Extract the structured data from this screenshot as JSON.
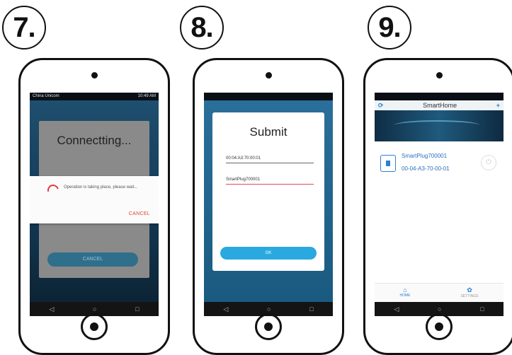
{
  "steps": [
    "7.",
    "8.",
    "9."
  ],
  "phone7": {
    "status_left": "China Unicom",
    "status_right": "10:49 AM",
    "dialog_title": "Connectting...",
    "alert_message": "Operation is taking place, please wait...",
    "alert_cancel": "CANCEL",
    "dialog_cancel": "CANCEL"
  },
  "phone8": {
    "dialog_title": "Submit",
    "field1_value": "00:04:A3:70:00:01",
    "field2_value": "SmartPlug700001",
    "ok_label": "OK"
  },
  "phone9": {
    "app_title": "SmartHome",
    "refresh_icon": "refresh-icon",
    "add_icon": "plus-icon",
    "device_name": "SmartPlug700001",
    "device_mac": "00-04-A3-70-00-01",
    "tab_home": "HOME",
    "tab_settings": "SETTINGS"
  },
  "nav_glyphs": {
    "back": "◁",
    "home": "○",
    "recent": "□"
  },
  "colors": {
    "accent": "#29a9e0",
    "link": "#2a7fd8",
    "alert_action": "#e0452a"
  }
}
